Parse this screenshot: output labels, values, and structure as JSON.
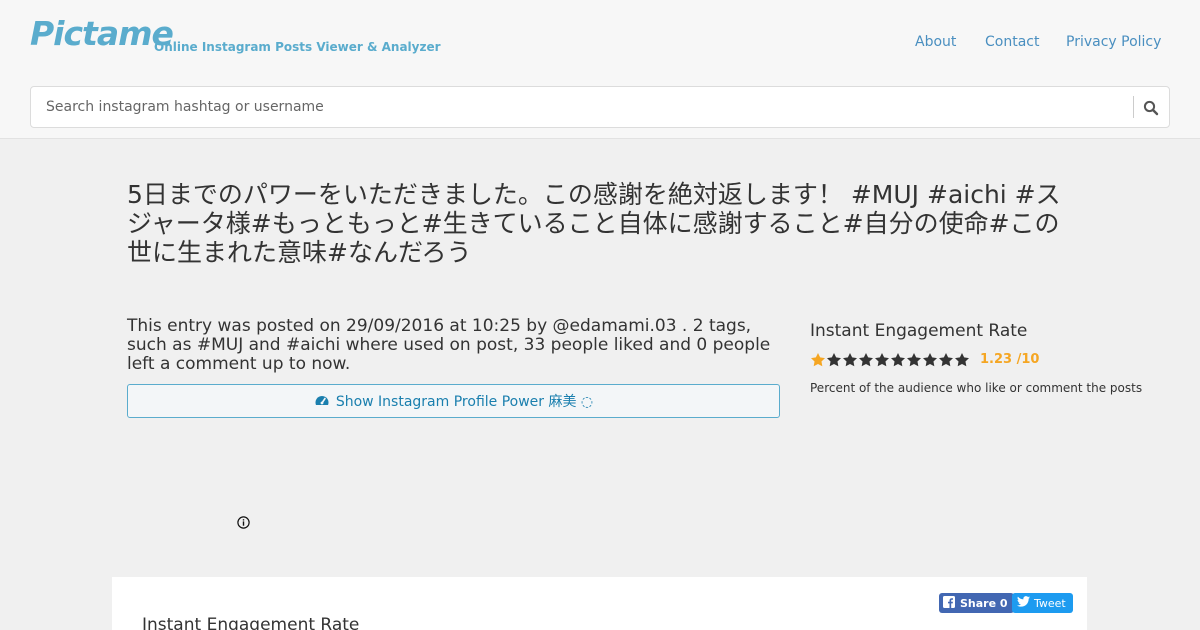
{
  "header": {
    "logo": "Pictame",
    "tagline": "Online Instagram Posts Viewer & Analyzer",
    "nav": {
      "about": "About",
      "contact": "Contact",
      "privacy": "Privacy Policy"
    }
  },
  "search": {
    "placeholder": "Search instagram hashtag or username"
  },
  "post": {
    "title": "5日までのパワーをいただきました。この感謝を絶対返します！ #MUJ #aichi #スジャータ様#もっともっと#生きていること自体に感謝すること#自分の使命#この世に生まれた意味#なんだろう",
    "description": "This entry was posted on 29/09/2016 at 10:25 by @edamami.03 . 2 tags, such as #MUJ and #aichi where used on post, 33 people liked and 0 people left a comment up to now.",
    "profile_button": "Show Instagram Profile Power 麻美 ◌"
  },
  "engagement": {
    "title": "Instant Engagement Rate",
    "rating": 1,
    "max": 10,
    "score": "1.23 /10",
    "subtitle": "Percent of the audience who like or comment the posts",
    "active_color": "#f5a623",
    "inactive_color": "#333333"
  },
  "card": {
    "share_label": "Share 0",
    "tweet_label": "Tweet",
    "title": "Instant Engagement Rate"
  }
}
